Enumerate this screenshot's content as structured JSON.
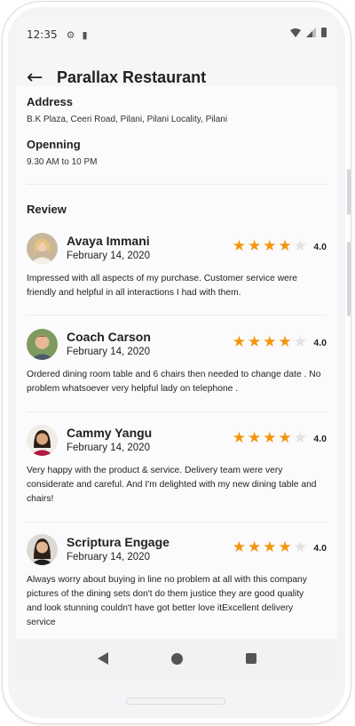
{
  "status_bar": {
    "time": "12:35",
    "icons": [
      "gear-icon",
      "sd-card-icon",
      "wifi-icon",
      "signal-icon",
      "battery-icon"
    ]
  },
  "app_bar": {
    "title": "Parallax Restaurant",
    "back_icon": "arrow-left-icon"
  },
  "details": {
    "address_label": "Address",
    "address_value": "B.K Plaza, Ceeri Road, Pilani, Pilani Locality, Pilani",
    "opening_label": "Openning",
    "opening_value": "9.30 AM to 10 PM"
  },
  "reviews_section": {
    "title": "Review",
    "items": [
      {
        "name": "Avaya Immani",
        "date": "February 14, 2020",
        "rating": "4.0",
        "stars_filled": 4,
        "text": "Impressed with all aspects of my purchase. Customer service were friendly and helpful in all interactions I had with them."
      },
      {
        "name": "Coach Carson",
        "date": "February 14, 2020",
        "rating": "4.0",
        "stars_filled": 4,
        "text": "Ordered dining room table and 6 chairs then needed to change date . No problem whatsoever very helpful lady on telephone ."
      },
      {
        "name": "Cammy Yangu",
        "date": "February 14, 2020",
        "rating": "4.0",
        "stars_filled": 4,
        "text": "Very happy with the product & service. Delivery team were very considerate and careful. And I'm delighted with my new dining table and chairs!"
      },
      {
        "name": "Scriptura Engage",
        "date": "February 14, 2020",
        "rating": "4.0",
        "stars_filled": 4,
        "text": "Always worry about buying in line no problem at all with this company pictures of the dining sets don't do them justice they are good quality and look stunning couldn't have got better love itExcellent delivery service"
      }
    ]
  },
  "colors": {
    "star_filled": "#f2960b",
    "star_empty": "#e2e2e4",
    "text": "#222222"
  }
}
